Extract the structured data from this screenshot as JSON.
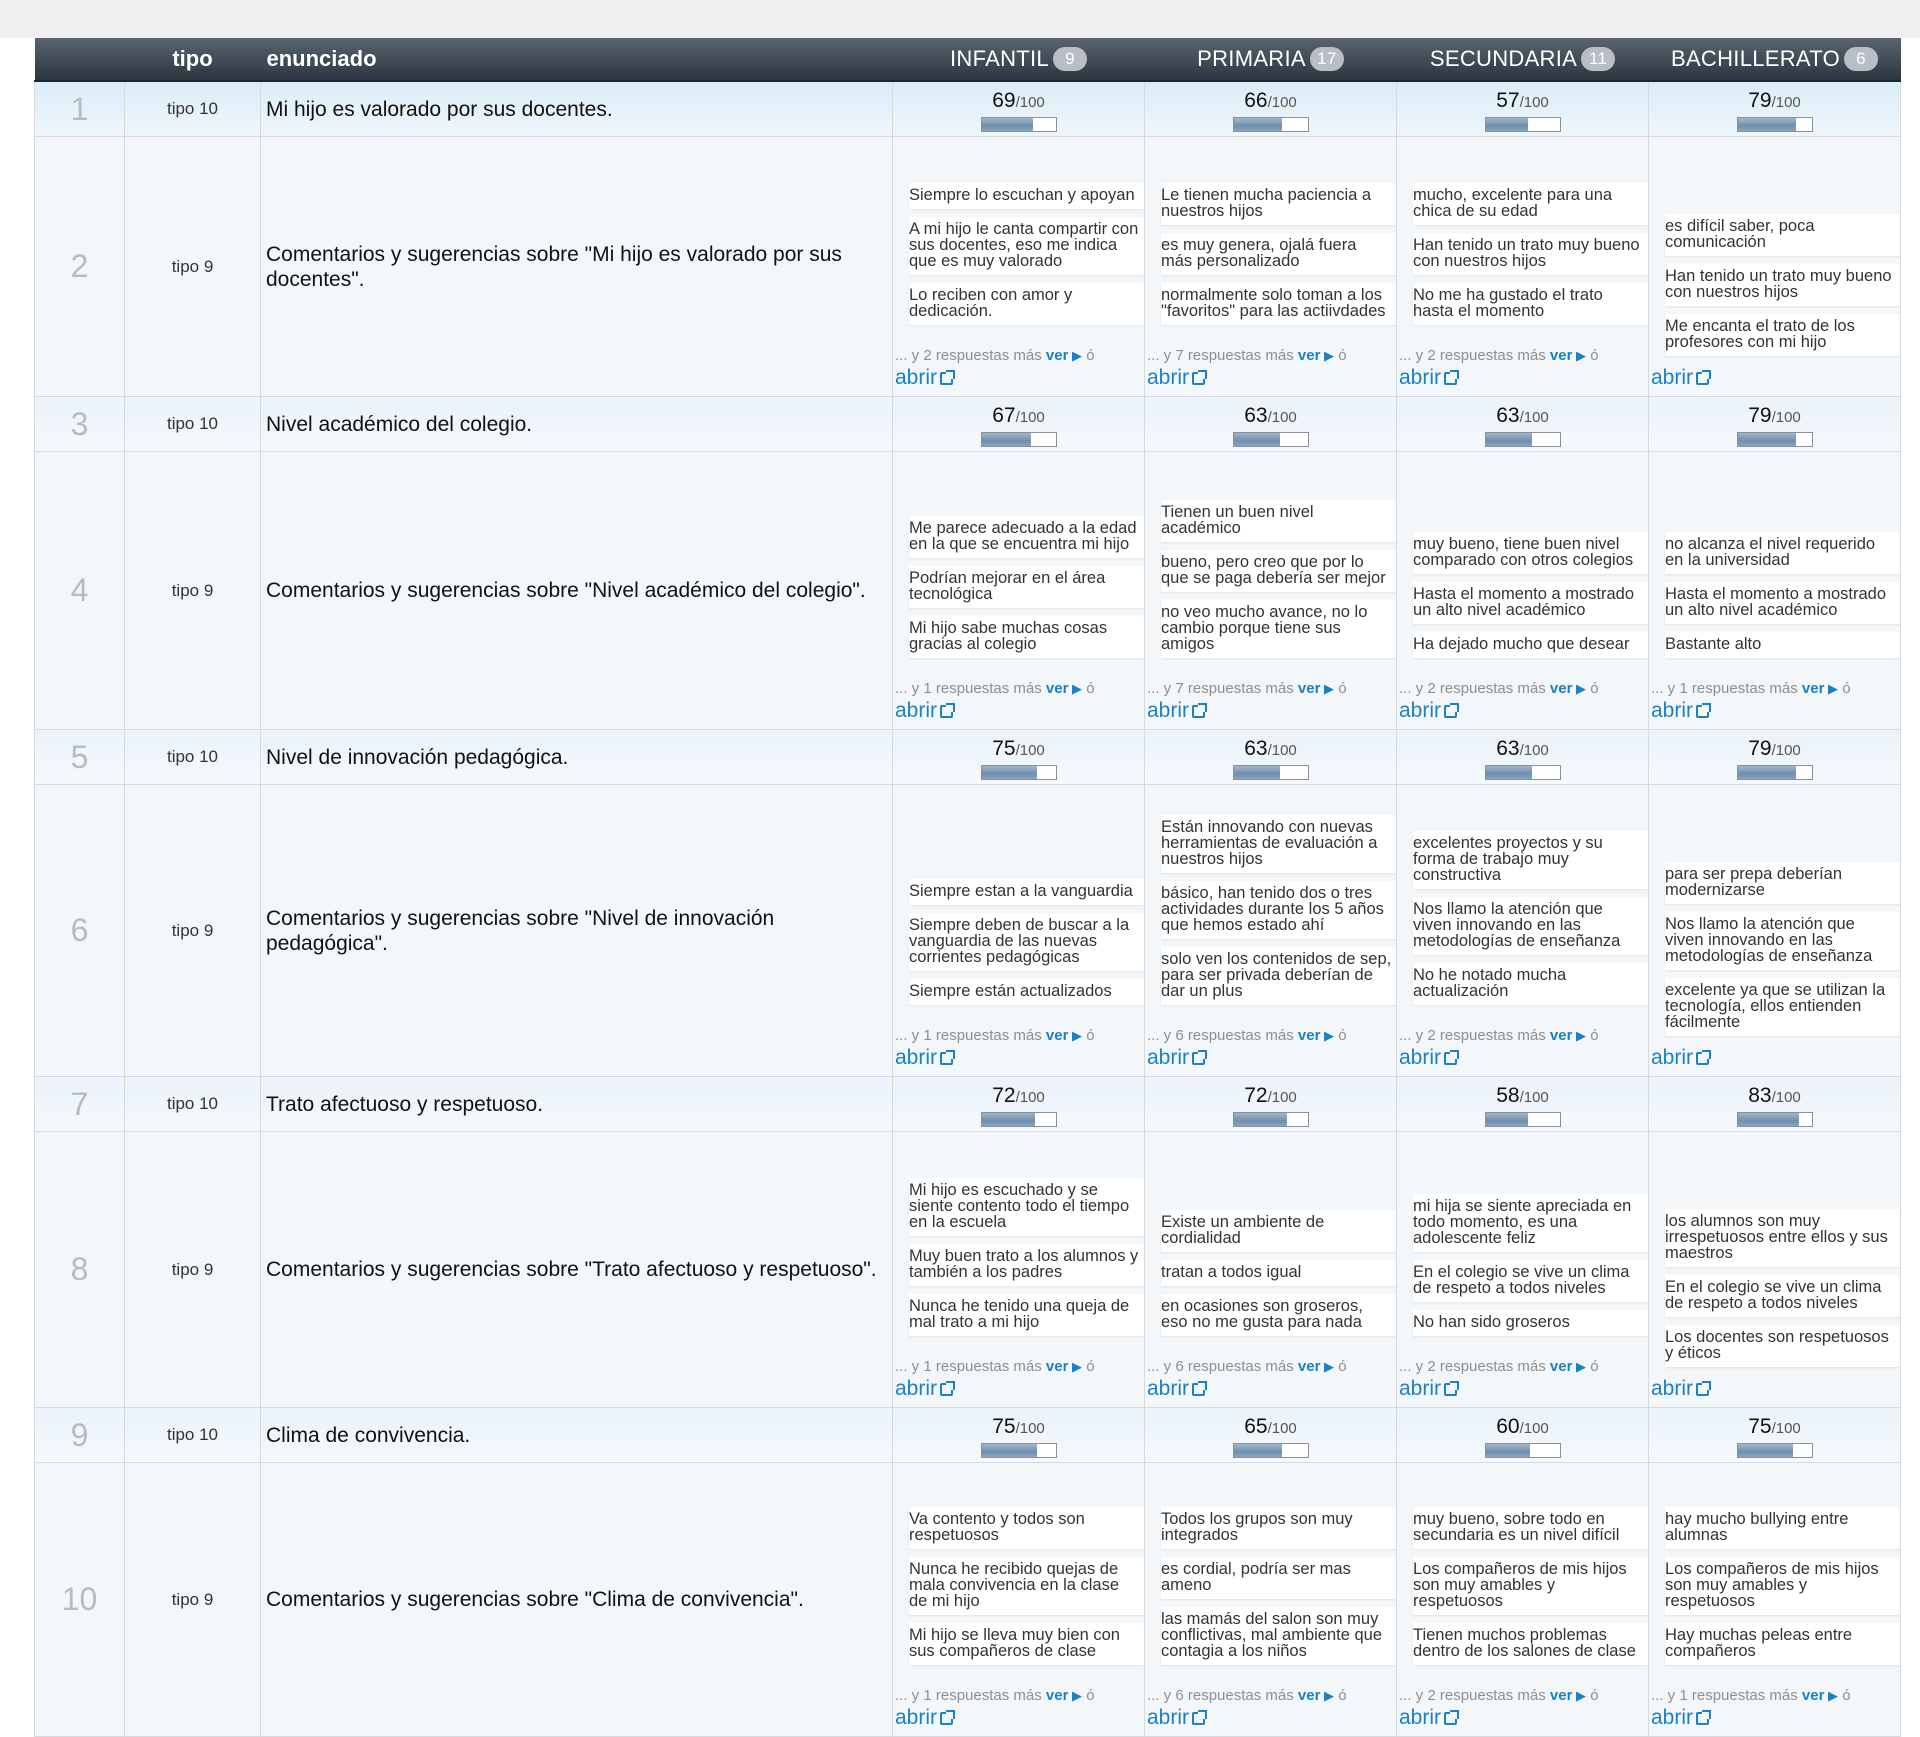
{
  "header": {
    "tipo": "tipo",
    "enunciado": "enunciado",
    "levels": [
      {
        "label": "INFANTIL",
        "count": "9"
      },
      {
        "label": "PRIMARIA",
        "count": "17"
      },
      {
        "label": "SECUNDARIA",
        "count": "11"
      },
      {
        "label": "BACHILLERATO",
        "count": "6"
      }
    ]
  },
  "labels": {
    "max": "/100",
    "more_prefix": "... y ",
    "more_suffix": " respuestas más ",
    "ver": "ver",
    "o": " ó",
    "abrir": "abrir"
  },
  "rows": [
    {
      "num": "1",
      "type": "score",
      "tipo": "tipo 10",
      "text": "Mi hijo es valorado por sus docentes.",
      "scores": [
        69,
        66,
        57,
        79
      ]
    },
    {
      "num": "2",
      "type": "comments",
      "tipo": "tipo 9",
      "text": "Comentarios y sugerencias sobre \"Mi hijo es valorado por sus docentes\".",
      "cells": [
        {
          "items": [
            "Siempre lo escuchan y apoyan",
            "A mi hijo le canta compartir con sus docentes, eso me indica que es muy valorado",
            "Lo reciben con amor y dedicación."
          ],
          "more": "2"
        },
        {
          "items": [
            "Le tienen mucha paciencia a nuestros hijos",
            "es muy genera, ojalá fuera más personalizado",
            "normalmente solo toman a los \"favoritos\" para las actiivdades"
          ],
          "more": "7"
        },
        {
          "items": [
            "mucho, excelente para una chica de su edad",
            "Han tenido un trato muy bueno con nuestros hijos",
            "No me ha gustado el trato hasta el momento"
          ],
          "more": "2"
        },
        {
          "items": [
            "es difícil saber, poca comunicación",
            "Han tenido un trato muy bueno con nuestros hijos",
            "Me encanta el trato de los profesores con mi hijo"
          ],
          "more": ""
        }
      ]
    },
    {
      "num": "3",
      "type": "score",
      "tipo": "tipo 10",
      "text": "Nivel académico del colegio.",
      "scores": [
        67,
        63,
        63,
        79
      ]
    },
    {
      "num": "4",
      "type": "comments",
      "tipo": "tipo 9",
      "text": "Comentarios y sugerencias sobre \"Nivel académico del colegio\".",
      "cells": [
        {
          "items": [
            "Me parece adecuado a la edad en la que se encuentra mi hijo",
            "Podrían mejorar en el área tecnológica",
            "Mi hijo sabe muchas cosas gracias al colegio"
          ],
          "more": "1"
        },
        {
          "items": [
            "Tienen un buen nivel académico",
            "bueno, pero creo que por lo que se paga debería ser mejor",
            "no veo mucho avance, no lo cambio porque tiene sus amigos"
          ],
          "more": "7"
        },
        {
          "items": [
            "muy bueno, tiene buen nivel comparado con otros colegios",
            "Hasta el momento a mostrado un alto nivel académico",
            "Ha dejado mucho que desear"
          ],
          "more": "2"
        },
        {
          "items": [
            "no alcanza el nivel requerido en la universidad",
            "Hasta el momento a mostrado un alto nivel académico",
            "Bastante alto"
          ],
          "more": "1"
        }
      ]
    },
    {
      "num": "5",
      "type": "score",
      "tipo": "tipo 10",
      "text": "Nivel de innovación pedagógica.",
      "scores": [
        75,
        63,
        63,
        79
      ]
    },
    {
      "num": "6",
      "type": "comments",
      "tipo": "tipo 9",
      "text": "Comentarios y sugerencias sobre \"Nivel de innovación pedagógica\".",
      "cells": [
        {
          "items": [
            "Siempre estan a la vanguardia",
            "Siempre deben de buscar a la vanguardia de las nuevas corrientes pedagógicas",
            "Siempre están actualizados"
          ],
          "more": "1"
        },
        {
          "items": [
            "Están innovando con nuevas herramientas de evaluación a nuestros hijos",
            "básico, han tenido dos o tres actividades durante los 5 años que hemos estado ahí",
            "solo ven los contenidos de sep, para ser privada deberían de dar un plus"
          ],
          "more": "6"
        },
        {
          "items": [
            "excelentes proyectos y su forma de trabajo muy constructiva",
            "Nos llamo la atención que viven innovando en las metodologías de enseñanza",
            "No he notado mucha actualización"
          ],
          "more": "2"
        },
        {
          "items": [
            "para ser prepa deberían modernizarse",
            "Nos llamo la atención que viven innovando en las metodologías de enseñanza",
            "excelente ya que se utilizan la tecnología, ellos entienden fácilmente"
          ],
          "more": ""
        }
      ]
    },
    {
      "num": "7",
      "type": "score",
      "tipo": "tipo 10",
      "text": "Trato afectuoso y respetuoso.",
      "scores": [
        72,
        72,
        58,
        83
      ]
    },
    {
      "num": "8",
      "type": "comments",
      "tipo": "tipo 9",
      "text": "Comentarios y sugerencias sobre \"Trato afectuoso y respetuoso\".",
      "cells": [
        {
          "items": [
            "Mi hijo es escuchado y se siente contento todo el tiempo en la escuela",
            "Muy buen trato a los alumnos y también a los padres",
            "Nunca he tenido una queja de mal trato a mi hijo"
          ],
          "more": "1"
        },
        {
          "items": [
            "Existe un ambiente de cordialidad",
            "tratan a todos igual",
            "en ocasiones son groseros, eso no me gusta para nada"
          ],
          "more": "6"
        },
        {
          "items": [
            "mi hija se siente apreciada en todo momento, es una adolescente feliz",
            "En el colegio se vive un clima de respeto a todos niveles",
            "No han sido groseros"
          ],
          "more": "2"
        },
        {
          "items": [
            "los alumnos son muy irrespetuosos entre ellos y sus maestros",
            "En el colegio se vive un clima de respeto a todos niveles",
            "Los docentes son respetuosos y éticos"
          ],
          "more": ""
        }
      ]
    },
    {
      "num": "9",
      "type": "score",
      "tipo": "tipo 10",
      "text": "Clima de convivencia.",
      "scores": [
        75,
        65,
        60,
        75
      ]
    },
    {
      "num": "10",
      "type": "comments",
      "tipo": "tipo 9",
      "text": "Comentarios y sugerencias sobre \"Clima de convivencia\".",
      "cells": [
        {
          "items": [
            "Va contento y todos son respetuosos",
            "Nunca he recibido quejas de mala convivencia en la clase de mi hijo",
            "Mi hijo se lleva muy bien con sus compañeros de clase"
          ],
          "more": "1"
        },
        {
          "items": [
            "Todos los grupos son muy integrados",
            "es cordial, podría ser mas ameno",
            "las mamás del salon son muy conflictivas, mal ambiente que contagia a los niños"
          ],
          "more": "6"
        },
        {
          "items": [
            "muy bueno, sobre todo en secundaria es un nivel difícil",
            "Los compañeros de mis hijos son muy amables y respetuosos",
            "Tienen muchos problemas dentro de los salones de clase"
          ],
          "more": "2"
        },
        {
          "items": [
            "hay mucho bullying entre alumnas",
            "Los compañeros de mis hijos son muy amables y respetuosos",
            "Hay muchas peleas entre compañeros"
          ],
          "more": "1"
        }
      ]
    }
  ]
}
